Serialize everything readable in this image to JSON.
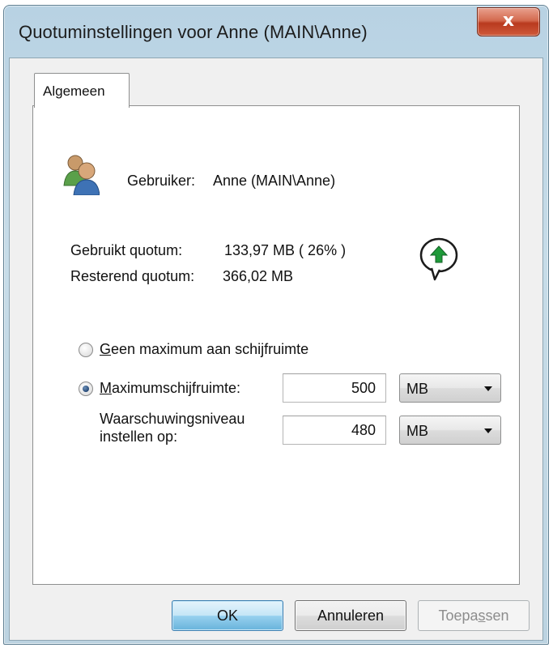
{
  "window": {
    "title": "Quotuminstellingen voor Anne (MAIN\\Anne)",
    "close_glyph": "x"
  },
  "tabs": [
    {
      "label": "Algemeen",
      "selected": true
    }
  ],
  "user": {
    "label": "Gebruiker:",
    "value": "Anne (MAIN\\Anne)",
    "icon": "users-icon"
  },
  "quota": {
    "used_label": "Gebruikt quotum:",
    "used_value": "133,97 MB ( 26% )",
    "remaining_label": "Resterend quotum:",
    "remaining_value": "366,02 MB",
    "status_icon": "quota-ok-arrow-icon",
    "status_color": "#1f9a3a"
  },
  "options": {
    "no_limit": {
      "label_accel": "G",
      "label_rest": "een maximum aan schijfruimte",
      "selected": false
    },
    "limit": {
      "label_accel": "M",
      "label_rest": "aximumschijfruimte:",
      "selected": true,
      "value": "500",
      "unit": "MB"
    },
    "warning": {
      "label_line1": "Waarschuwingsniveau",
      "label_line2": "instellen op:",
      "value": "480",
      "unit": "MB"
    }
  },
  "buttons": {
    "ok": "OK",
    "cancel": "Annuleren",
    "apply_before": "Toepa",
    "apply_accel": "s",
    "apply_after": "sen"
  }
}
